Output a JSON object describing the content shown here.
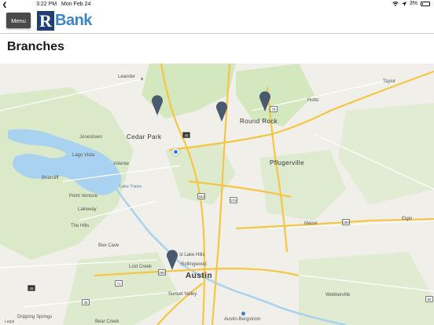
{
  "status_bar": {
    "back_glyph": "❮",
    "time": "3:22 PM",
    "date": "Mon Feb 24",
    "battery_text": "3%"
  },
  "header": {
    "menu_label": "Menu",
    "logo_letter": "R",
    "logo_text": "Bank"
  },
  "page": {
    "title": "Branches"
  },
  "map": {
    "labels": {
      "leander": "Leander",
      "taylor": "Taylor",
      "hutto": "Hutto",
      "cedar_park": "Cedar Park",
      "round_rock": "Round Rock",
      "jonestown": "Jonestown",
      "lago_vista": "Lago Vista",
      "volente": "Volente",
      "pflugerville": "Pflugerville",
      "briarcliff": "Briarcliff",
      "point_venture": "Point Venture",
      "lake_travis": "Lake Travis",
      "lakeway": "Lakeway",
      "the_hills": "The Hills",
      "elgin": "Elgin",
      "manor": "Manor",
      "bee_cave": "Bee Cave",
      "west_lake_hills": "st Lake Hills",
      "rollingwood": "Rollingwood",
      "lost_creek": "Lost Creek",
      "austin": "Austin",
      "sunset_valley": "Sunset Valley",
      "webberville": "Webberville",
      "dripping_springs": "Dripping Springs",
      "bear_creek": "Bear Creek",
      "airport": "Austin-Bergstrom"
    },
    "shields": {
      "r79": "79",
      "r183": "183",
      "r275": "275",
      "r290a": "290",
      "r290b": "290",
      "r71": "71",
      "r35": "35",
      "t45a": "45",
      "t45b": "45",
      "t95": "95"
    },
    "legal": "Legal",
    "colors": {
      "land": "#f1efe9",
      "park": "#cfe6b8",
      "water": "#a9d2f0",
      "highway": "#f5c544",
      "road": "#ffffff",
      "pin": "#4a5a6e",
      "user_location": "#2f7ff0"
    }
  }
}
